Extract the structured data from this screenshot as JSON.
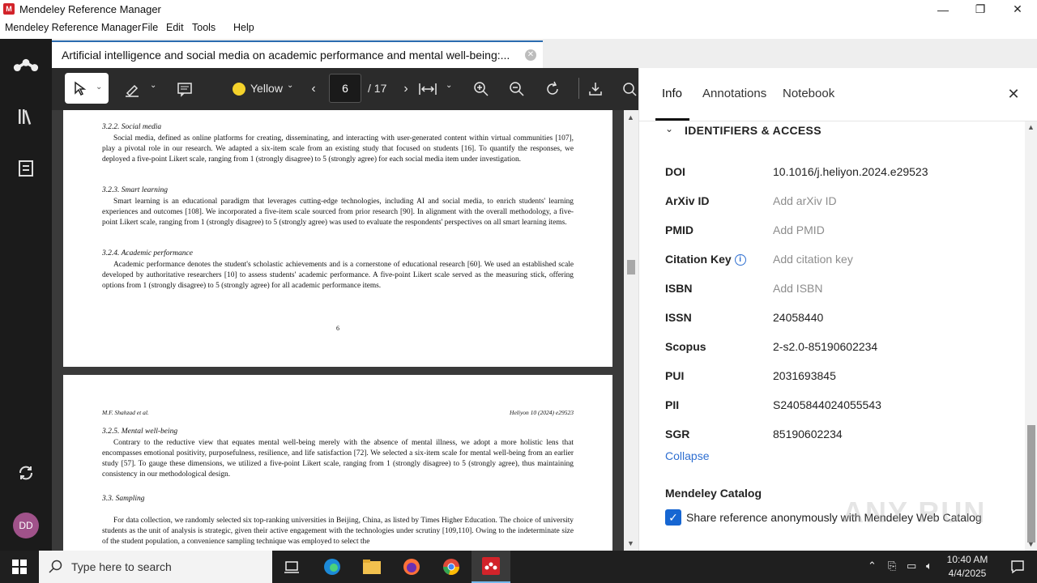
{
  "window": {
    "title": "Mendeley Reference Manager",
    "logo_text": "M"
  },
  "menu": {
    "items": [
      "Mendeley Reference Manager",
      "File",
      "Edit",
      "Tools",
      "Help"
    ]
  },
  "sidebar": {
    "avatar_initials": "DD"
  },
  "tab": {
    "title": "Artificial intelligence and social media on academic performance and mental well-being:..."
  },
  "toolbar": {
    "highlight_color": "Yellow",
    "highlight_hex": "#f4d22b",
    "current_page": "6",
    "total_pages": "/ 17"
  },
  "pdf": {
    "page1": {
      "sections": [
        {
          "heading": "3.2.2.  Social media",
          "text": "Social media, defined as online platforms for creating, disseminating, and interacting with user-generated content within virtual communities [107], play a pivotal role in our research. We adapted a six-item scale from an existing study that focused on students [16]. To quantify the responses, we deployed a five-point Likert scale, ranging from 1 (strongly disagree) to 5 (strongly agree) for each social media item under investigation."
        },
        {
          "heading": "3.2.3.  Smart learning",
          "text": "Smart learning is an educational paradigm that leverages cutting-edge technologies, including AI and social media, to enrich students' learning experiences and outcomes [108]. We incorporated a five-item scale sourced from prior research [90]. In alignment with the overall methodology, a five-point Likert scale, ranging from 1 (strongly disagree) to 5 (strongly agree) was used to evaluate the respondents' perspectives on all smart learning items."
        },
        {
          "heading": "3.2.4.  Academic performance",
          "text": "Academic performance denotes the student's scholastic achievements and is a cornerstone of educational research [60]. We used an established scale developed by authoritative researchers [10] to assess students' academic performance. A five-point Likert scale served as the measuring stick, offering options from 1 (strongly disagree) to 5 (strongly agree) for all academic performance items."
        }
      ],
      "page_number": "6"
    },
    "page2": {
      "header_left": "M.F. Shahzad et al.",
      "header_right": "Heliyon 10 (2024) e29523",
      "sections": [
        {
          "heading": "3.2.5.  Mental well-being",
          "text": "Contrary to the reductive view that equates mental well-being merely with the absence of mental illness, we adopt a more holistic lens that encompasses emotional positivity, purposefulness, resilience, and life satisfaction [72]. We selected a six-item scale for mental well-being from an earlier study [57]. To gauge these dimensions, we utilized a five-point Likert scale, ranging from 1 (strongly disagree) to 5 (strongly agree), thus maintaining consistency in our methodological design."
        },
        {
          "heading": "3.3.  Sampling",
          "text": "For data collection, we randomly selected six top-ranking universities in Beijing, China, as listed by Times Higher Education. The choice of university students as the unit of analysis is strategic, given their active engagement with the technologies under scrutiny [109,110]. Owing to the indeterminate size of the student population, a convenience sampling technique was employed to select the"
        }
      ]
    }
  },
  "info_panel": {
    "tabs": [
      "Info",
      "Annotations",
      "Notebook"
    ],
    "section_title": "IDENTIFIERS & ACCESS",
    "fields": [
      {
        "label": "DOI",
        "value": "10.1016/j.heliyon.2024.e29523",
        "placeholder": false
      },
      {
        "label": "ArXiv ID",
        "value": "Add arXiv ID",
        "placeholder": true
      },
      {
        "label": "PMID",
        "value": "Add PMID",
        "placeholder": true
      },
      {
        "label": "Citation Key",
        "value": "Add citation key",
        "placeholder": true
      },
      {
        "label": "ISBN",
        "value": "Add ISBN",
        "placeholder": true
      },
      {
        "label": "ISSN",
        "value": "24058440",
        "placeholder": false
      },
      {
        "label": "Scopus",
        "value": "2-s2.0-85190602234",
        "placeholder": false
      },
      {
        "label": "PUI",
        "value": "2031693845",
        "placeholder": false
      },
      {
        "label": "PII",
        "value": "S2405844024055543",
        "placeholder": false
      },
      {
        "label": "SGR",
        "value": "85190602234",
        "placeholder": false
      }
    ],
    "collapse_label": "Collapse",
    "catalog_title": "Mendeley Catalog",
    "share_label": "Share reference anonymously with Mendeley Web Catalog",
    "share_checked": true
  },
  "watermark": "ANY RUN",
  "taskbar": {
    "search_placeholder": "Type here to search",
    "time": "10:40 AM",
    "date": "4/4/2025"
  }
}
